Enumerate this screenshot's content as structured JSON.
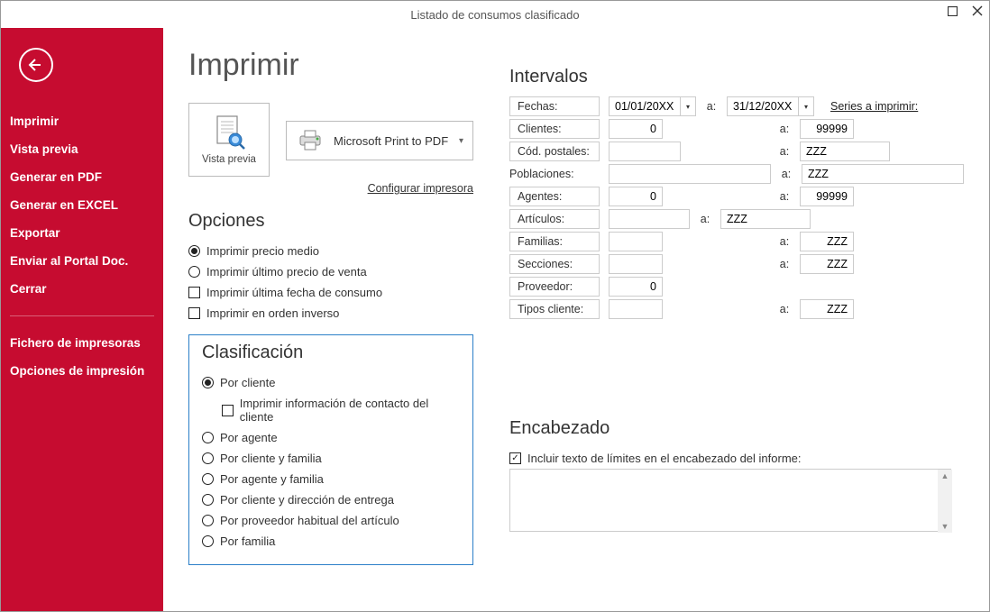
{
  "window": {
    "title": "Listado de consumos clasificado"
  },
  "sidebar": {
    "items": [
      "Imprimir",
      "Vista previa",
      "Generar en PDF",
      "Generar en EXCEL",
      "Exportar",
      "Enviar al Portal Doc.",
      "Cerrar"
    ],
    "items2": [
      "Fichero de impresoras",
      "Opciones de impresión"
    ]
  },
  "page": {
    "heading": "Imprimir",
    "preview_label": "Vista previa",
    "printer_name": "Microsoft Print to PDF",
    "configure_link": "Configurar impresora"
  },
  "options": {
    "heading": "Opciones",
    "items": [
      "Imprimir precio medio",
      "Imprimir último precio de venta",
      "Imprimir última fecha de consumo",
      "Imprimir en orden inverso"
    ]
  },
  "classification": {
    "heading": "Clasificación",
    "items": [
      "Por cliente",
      "Por agente",
      "Por cliente y familia",
      "Por agente y familia",
      "Por cliente y dirección de entrega",
      "Por proveedor habitual del artículo",
      "Por familia"
    ],
    "sub_checkbox": "Imprimir información de contacto del cliente"
  },
  "intervals": {
    "heading": "Intervalos",
    "a_label": "a:",
    "series_link": "Series a imprimir:",
    "fechas": {
      "label": "Fechas:",
      "from": "01/01/20XX",
      "to": "31/12/20XX"
    },
    "clientes": {
      "label": "Clientes:",
      "from": "0",
      "to": "99999"
    },
    "codpost": {
      "label": "Cód. postales:",
      "from": "",
      "to": "ZZZ"
    },
    "poblaciones": {
      "label": "Poblaciones:",
      "from": "",
      "to": "ZZZ"
    },
    "agentes": {
      "label": "Agentes:",
      "from": "0",
      "to": "99999"
    },
    "articulos": {
      "label": "Artículos:",
      "from": "",
      "to": "ZZZ"
    },
    "familias": {
      "label": "Familias:",
      "from": "",
      "to": "ZZZ"
    },
    "secciones": {
      "label": "Secciones:",
      "from": "",
      "to": "ZZZ"
    },
    "proveedor": {
      "label": "Proveedor:",
      "from": "0"
    },
    "tipos": {
      "label": "Tipos cliente:",
      "from": "",
      "to": "ZZZ"
    }
  },
  "header": {
    "heading": "Encabezado",
    "checkbox": "Incluir texto de límites en el encabezado del informe:"
  }
}
